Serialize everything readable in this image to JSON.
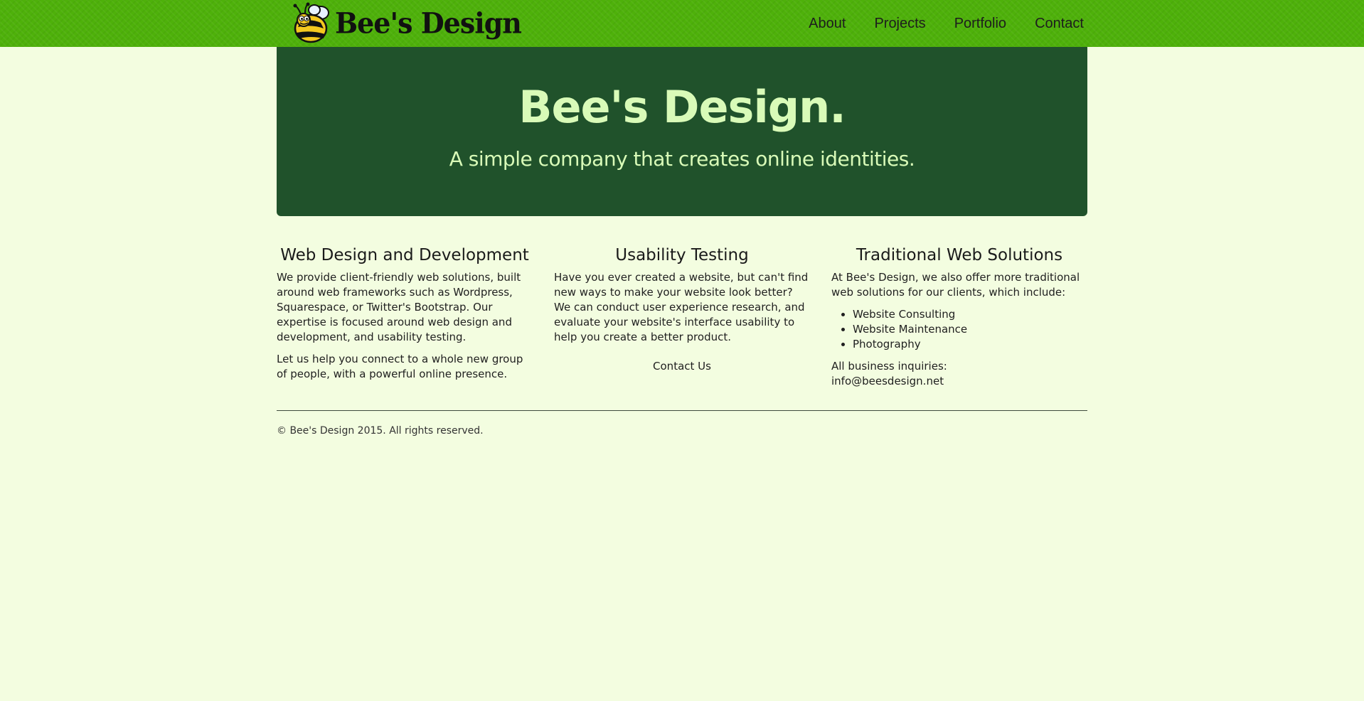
{
  "brand": {
    "name": "Bee's Design"
  },
  "nav": {
    "items": [
      "About",
      "Projects",
      "Portfolio",
      "Contact"
    ]
  },
  "hero": {
    "title": "Bee's Design.",
    "subtitle": "A simple company that creates online identities."
  },
  "columns": {
    "web": {
      "heading": "Web Design and Development",
      "p1": "We provide client-friendly web solutions, built around web frameworks such as Wordpress, Squarespace, or Twitter's Bootstrap. Our expertise is focused around web design and development, and usability testing.",
      "p2": "Let us help you connect to a whole new group of people, with a powerful online presence."
    },
    "usability": {
      "heading": "Usability Testing",
      "p1": "Have you ever created a website, but can't find new ways to make your website look better? We can conduct user experience research, and evaluate your website's interface usability to help you create a better product.",
      "contact_label": "Contact Us"
    },
    "traditional": {
      "heading": "Traditional Web Solutions",
      "p1": "At Bee's Design, we also offer more traditional web solutions for our clients, which include:",
      "list": [
        "Website Consulting",
        "Website Maintenance",
        "Photography"
      ],
      "inquiries_label": "All business inquiries:",
      "email": "info@beesdesign.net"
    }
  },
  "footer": {
    "copyright": "© Bee's Design 2015. All rights reserved."
  },
  "colors": {
    "navbar": "#4eb10a",
    "hero": "#20522b",
    "hero_text": "#d9fbb8",
    "background": "#f3fde0"
  }
}
